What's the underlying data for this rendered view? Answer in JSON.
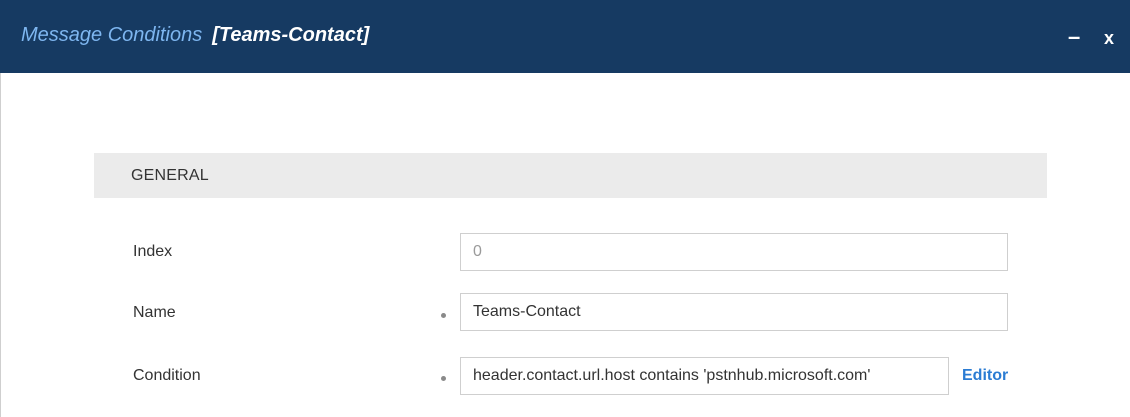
{
  "dialog": {
    "title": "Message Conditions",
    "subtitle": "[Teams-Contact]",
    "minimize_label": "–",
    "close_label": "x"
  },
  "section": {
    "title": "GENERAL"
  },
  "fields": {
    "index": {
      "label": "Index",
      "value": "0"
    },
    "name": {
      "label": "Name",
      "value": "Teams-Contact"
    },
    "condition": {
      "label": "Condition",
      "value": "header.contact.url.host contains 'pstnhub.microsoft.com'",
      "link": "Editor"
    }
  }
}
